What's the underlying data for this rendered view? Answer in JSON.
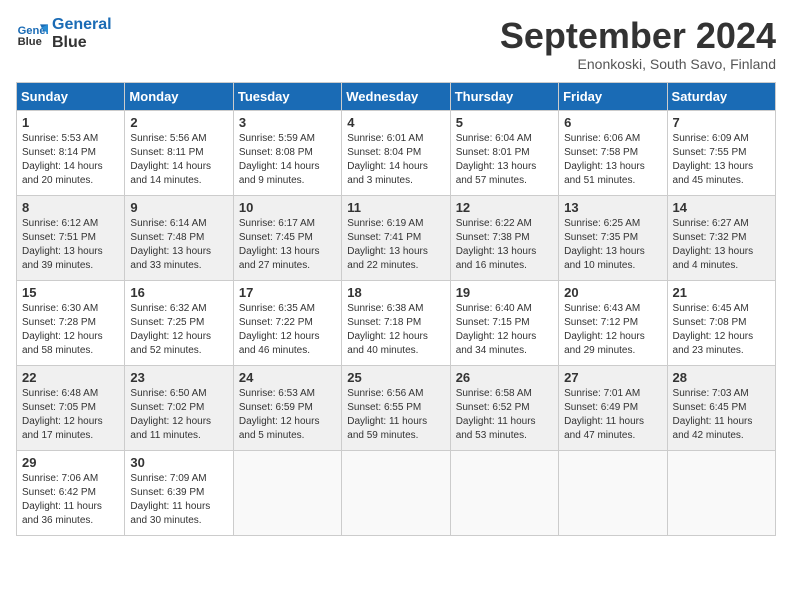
{
  "header": {
    "logo_line1": "General",
    "logo_line2": "Blue",
    "month": "September 2024",
    "location": "Enonkoski, South Savo, Finland"
  },
  "days_of_week": [
    "Sunday",
    "Monday",
    "Tuesday",
    "Wednesday",
    "Thursday",
    "Friday",
    "Saturday"
  ],
  "weeks": [
    [
      {
        "day": "1",
        "rise": "5:53 AM",
        "set": "8:14 PM",
        "daylight": "14 hours and 20 minutes."
      },
      {
        "day": "2",
        "rise": "5:56 AM",
        "set": "8:11 PM",
        "daylight": "14 hours and 14 minutes."
      },
      {
        "day": "3",
        "rise": "5:59 AM",
        "set": "8:08 PM",
        "daylight": "14 hours and 9 minutes."
      },
      {
        "day": "4",
        "rise": "6:01 AM",
        "set": "8:04 PM",
        "daylight": "14 hours and 3 minutes."
      },
      {
        "day": "5",
        "rise": "6:04 AM",
        "set": "8:01 PM",
        "daylight": "13 hours and 57 minutes."
      },
      {
        "day": "6",
        "rise": "6:06 AM",
        "set": "7:58 PM",
        "daylight": "13 hours and 51 minutes."
      },
      {
        "day": "7",
        "rise": "6:09 AM",
        "set": "7:55 PM",
        "daylight": "13 hours and 45 minutes."
      }
    ],
    [
      {
        "day": "8",
        "rise": "6:12 AM",
        "set": "7:51 PM",
        "daylight": "13 hours and 39 minutes."
      },
      {
        "day": "9",
        "rise": "6:14 AM",
        "set": "7:48 PM",
        "daylight": "13 hours and 33 minutes."
      },
      {
        "day": "10",
        "rise": "6:17 AM",
        "set": "7:45 PM",
        "daylight": "13 hours and 27 minutes."
      },
      {
        "day": "11",
        "rise": "6:19 AM",
        "set": "7:41 PM",
        "daylight": "13 hours and 22 minutes."
      },
      {
        "day": "12",
        "rise": "6:22 AM",
        "set": "7:38 PM",
        "daylight": "13 hours and 16 minutes."
      },
      {
        "day": "13",
        "rise": "6:25 AM",
        "set": "7:35 PM",
        "daylight": "13 hours and 10 minutes."
      },
      {
        "day": "14",
        "rise": "6:27 AM",
        "set": "7:32 PM",
        "daylight": "13 hours and 4 minutes."
      }
    ],
    [
      {
        "day": "15",
        "rise": "6:30 AM",
        "set": "7:28 PM",
        "daylight": "12 hours and 58 minutes."
      },
      {
        "day": "16",
        "rise": "6:32 AM",
        "set": "7:25 PM",
        "daylight": "12 hours and 52 minutes."
      },
      {
        "day": "17",
        "rise": "6:35 AM",
        "set": "7:22 PM",
        "daylight": "12 hours and 46 minutes."
      },
      {
        "day": "18",
        "rise": "6:38 AM",
        "set": "7:18 PM",
        "daylight": "12 hours and 40 minutes."
      },
      {
        "day": "19",
        "rise": "6:40 AM",
        "set": "7:15 PM",
        "daylight": "12 hours and 34 minutes."
      },
      {
        "day": "20",
        "rise": "6:43 AM",
        "set": "7:12 PM",
        "daylight": "12 hours and 29 minutes."
      },
      {
        "day": "21",
        "rise": "6:45 AM",
        "set": "7:08 PM",
        "daylight": "12 hours and 23 minutes."
      }
    ],
    [
      {
        "day": "22",
        "rise": "6:48 AM",
        "set": "7:05 PM",
        "daylight": "12 hours and 17 minutes."
      },
      {
        "day": "23",
        "rise": "6:50 AM",
        "set": "7:02 PM",
        "daylight": "12 hours and 11 minutes."
      },
      {
        "day": "24",
        "rise": "6:53 AM",
        "set": "6:59 PM",
        "daylight": "12 hours and 5 minutes."
      },
      {
        "day": "25",
        "rise": "6:56 AM",
        "set": "6:55 PM",
        "daylight": "11 hours and 59 minutes."
      },
      {
        "day": "26",
        "rise": "6:58 AM",
        "set": "6:52 PM",
        "daylight": "11 hours and 53 minutes."
      },
      {
        "day": "27",
        "rise": "7:01 AM",
        "set": "6:49 PM",
        "daylight": "11 hours and 47 minutes."
      },
      {
        "day": "28",
        "rise": "7:03 AM",
        "set": "6:45 PM",
        "daylight": "11 hours and 42 minutes."
      }
    ],
    [
      {
        "day": "29",
        "rise": "7:06 AM",
        "set": "6:42 PM",
        "daylight": "11 hours and 36 minutes."
      },
      {
        "day": "30",
        "rise": "7:09 AM",
        "set": "6:39 PM",
        "daylight": "11 hours and 30 minutes."
      },
      null,
      null,
      null,
      null,
      null
    ]
  ]
}
